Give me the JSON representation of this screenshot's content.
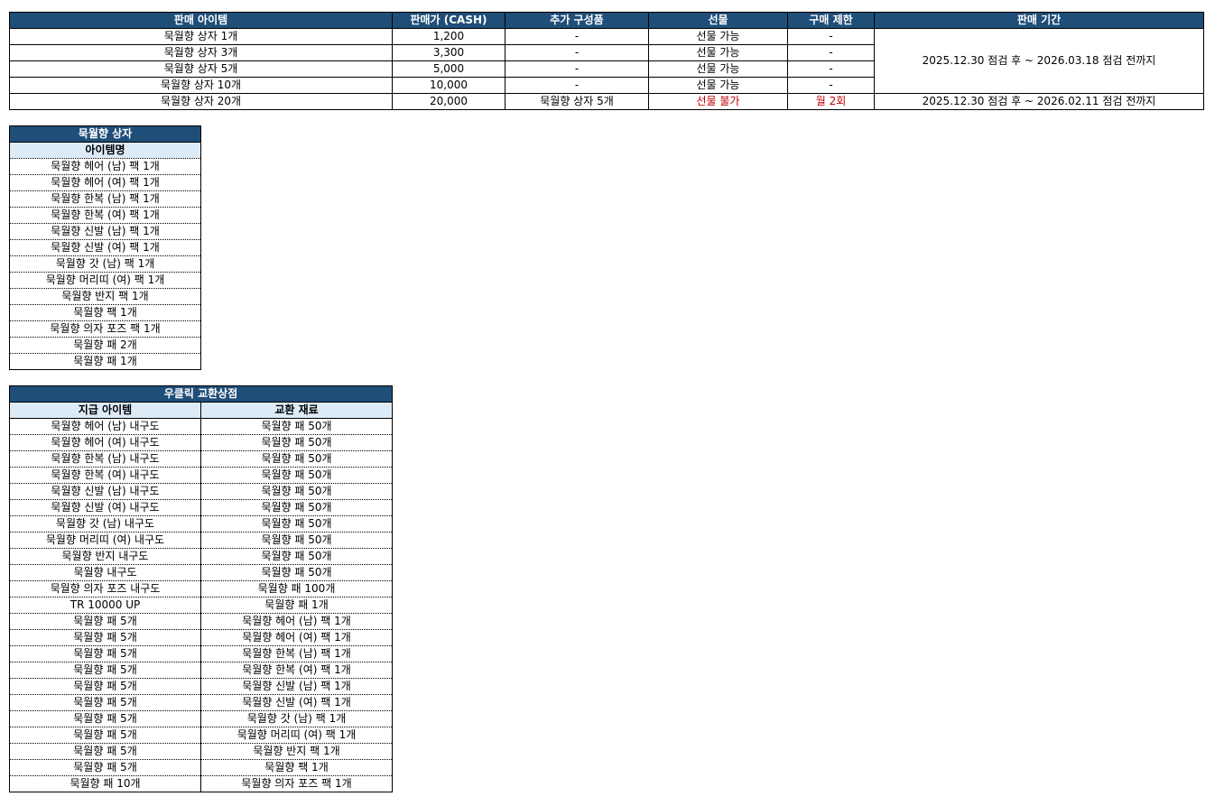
{
  "sales": {
    "headers": [
      "판매 아이템",
      "판매가 (CASH)",
      "추가 구성품",
      "선물",
      "구매 제한",
      "판매 기간"
    ],
    "rows": [
      {
        "item": "묵월향 상자 1개",
        "price": "1,200",
        "extra": "-",
        "gift": "선물 가능",
        "limit": "-"
      },
      {
        "item": "묵월향 상자 3개",
        "price": "3,300",
        "extra": "-",
        "gift": "선물 가능",
        "limit": "-"
      },
      {
        "item": "묵월향 상자 5개",
        "price": "5,000",
        "extra": "-",
        "gift": "선물 가능",
        "limit": "-"
      },
      {
        "item": "묵월향 상자 10개",
        "price": "10,000",
        "extra": "-",
        "gift": "선물 가능",
        "limit": "-"
      },
      {
        "item": "묵월향 상자 20개",
        "price": "20,000",
        "extra": "묵월향 상자 5개",
        "gift": "선물 불가",
        "limit": "월 2회"
      }
    ],
    "period_main": "2025.12.30 점검 후 ~ 2026.03.18 점검 전까지",
    "period_last": "2025.12.30 점검 후 ~ 2026.02.11 점검 전까지",
    "accent_color": "#1f4e79",
    "subheader_color": "#ddebf7",
    "warning_color": "#c00000"
  },
  "box": {
    "title": "묵월향 상자",
    "column": "아이템명",
    "items": [
      "묵월향 헤어 (남) 팩 1개",
      "묵월향 헤어 (여) 팩 1개",
      "묵월향 한복 (남) 팩 1개",
      "묵월향 한복 (여) 팩 1개",
      "묵월향 신발 (남) 팩 1개",
      "묵월향 신발 (여) 팩 1개",
      "묵월향 갓 (남) 팩 1개",
      "묵월향 머리띠 (여) 팩 1개",
      "묵월향 반지 팩 1개",
      "묵월향 팩 1개",
      "묵월향 의자 포즈 팩 1개",
      "묵월향 패 2개",
      "묵월향 패 1개"
    ]
  },
  "shop": {
    "title": "우클릭 교환상점",
    "col_give": "지급 아이템",
    "col_material": "교환 재료",
    "rows": [
      {
        "give": "묵월향 헤어 (남) 내구도",
        "material": "묵월향 패 50개"
      },
      {
        "give": "묵월향 헤어 (여) 내구도",
        "material": "묵월향 패 50개"
      },
      {
        "give": "묵월향 한복 (남) 내구도",
        "material": "묵월향 패 50개"
      },
      {
        "give": "묵월향 한복 (여) 내구도",
        "material": "묵월향 패 50개"
      },
      {
        "give": "묵월향 신발 (남) 내구도",
        "material": "묵월향 패 50개"
      },
      {
        "give": "묵월향 신발 (여) 내구도",
        "material": "묵월향 패 50개"
      },
      {
        "give": "묵월향 갓 (남) 내구도",
        "material": "묵월향 패 50개"
      },
      {
        "give": "묵월향 머리띠 (여) 내구도",
        "material": "묵월향 패 50개"
      },
      {
        "give": "묵월향 반지 내구도",
        "material": "묵월향 패 50개"
      },
      {
        "give": "묵월향 내구도",
        "material": "묵월향 패 50개"
      },
      {
        "give": "묵월향 의자 포즈 내구도",
        "material": "묵월향 패 100개"
      },
      {
        "give": "TR 10000 UP",
        "material": "묵월향 패 1개"
      },
      {
        "give": "묵월향 패 5개",
        "material": "묵월향 헤어 (남) 팩 1개"
      },
      {
        "give": "묵월향 패 5개",
        "material": "묵월향 헤어 (여) 팩 1개"
      },
      {
        "give": "묵월향 패 5개",
        "material": "묵월향 한복 (남) 팩 1개"
      },
      {
        "give": "묵월향 패 5개",
        "material": "묵월향 한복 (여) 팩 1개"
      },
      {
        "give": "묵월향 패 5개",
        "material": "묵월향 신발 (남) 팩 1개"
      },
      {
        "give": "묵월향 패 5개",
        "material": "묵월향 신발 (여) 팩 1개"
      },
      {
        "give": "묵월향 패 5개",
        "material": "묵월향 갓 (남) 팩 1개"
      },
      {
        "give": "묵월향 패 5개",
        "material": "묵월향 머리띠 (여) 팩 1개"
      },
      {
        "give": "묵월향 패 5개",
        "material": "묵월향 반지 팩 1개"
      },
      {
        "give": "묵월향 패 5개",
        "material": "묵월향 팩 1개"
      },
      {
        "give": "묵월향 패 10개",
        "material": "묵월향 의자 포즈 팩 1개"
      }
    ]
  }
}
